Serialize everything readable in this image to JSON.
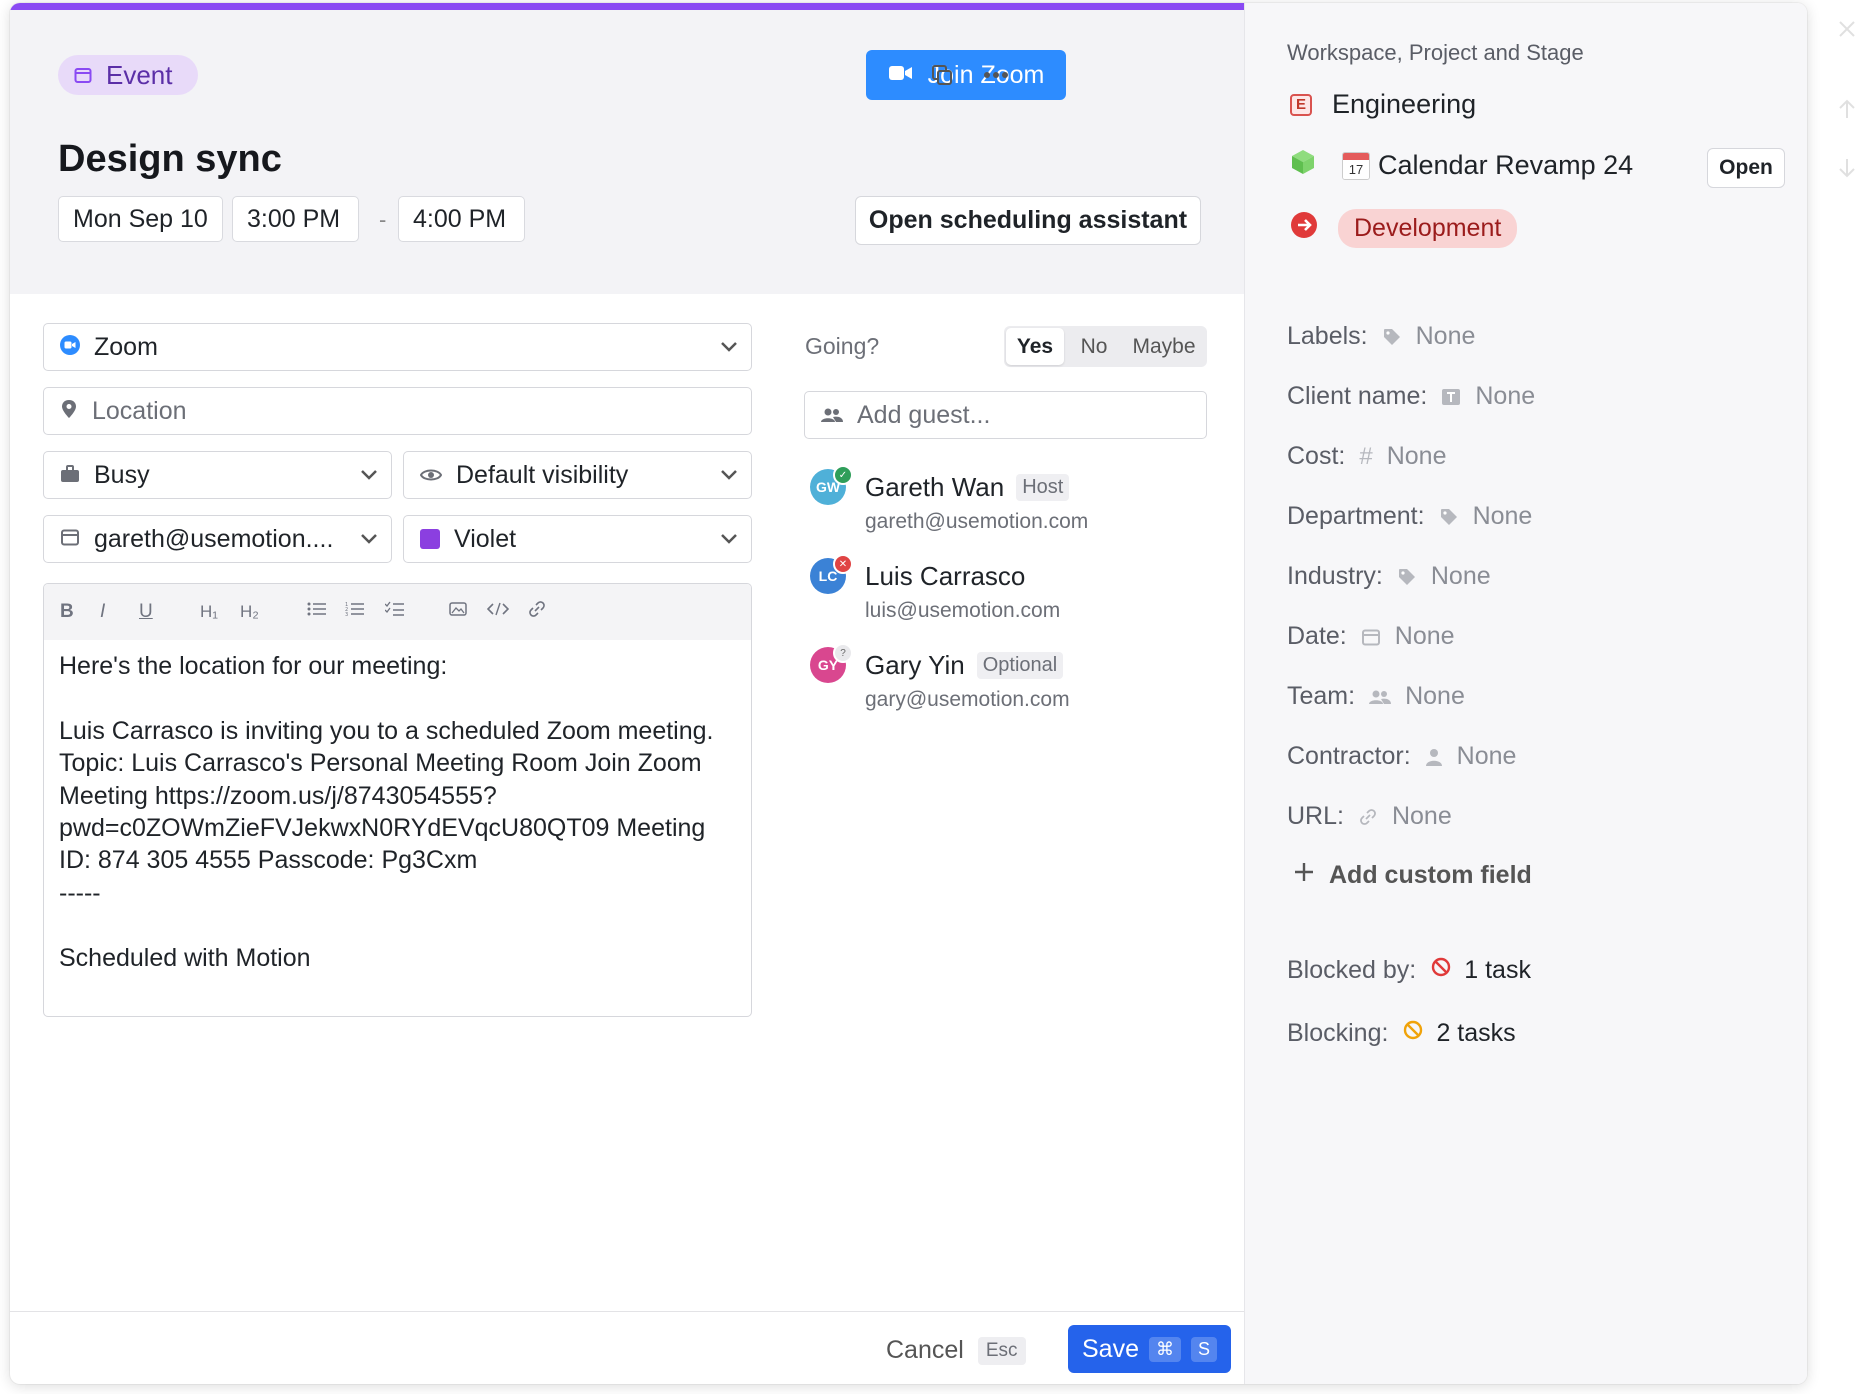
{
  "header": {
    "badge_label": "Event",
    "join_button": "Join Zoom",
    "title": "Design sync",
    "date": "Mon Sep 10",
    "start_time": "3:00 PM",
    "separator": "-",
    "end_time": "4:00 PM",
    "scheduling_button": "Open scheduling assistant"
  },
  "form": {
    "conferencing": "Zoom",
    "location_placeholder": "Location",
    "busy": "Busy",
    "visibility": "Default visibility",
    "calendar": "gareth@usemotion....",
    "color_label": "Violet",
    "color_hex": "#8b3fe0"
  },
  "description": "Here's the location for our meeting:\n\nLuis Carrasco is inviting you to a scheduled Zoom meeting. Topic: Luis Carrasco's Personal Meeting Room Join Zoom Meeting https://zoom.us/j/8743054555?pwd=c0ZOWmZieFVJekwxN0RYdEVqcU80QT09 Meeting ID: 874 305 4555 Passcode: Pg3Cxm\n-----\n\nScheduled with Motion",
  "editor_toolbar": [
    "bold",
    "italic",
    "underline",
    "heading-1",
    "heading-2",
    "bullet-list",
    "numbered-list",
    "checklist",
    "image",
    "code",
    "link"
  ],
  "going": {
    "label": "Going?",
    "options": [
      "Yes",
      "No",
      "Maybe"
    ],
    "selected": "Yes"
  },
  "guests": {
    "add_placeholder": "Add guest...",
    "list": [
      {
        "initials": "GW",
        "name": "Gareth Wan",
        "tag": "Host",
        "email": "gareth@usemotion.com",
        "color": "#4fb0d8",
        "status": "accepted"
      },
      {
        "initials": "LC",
        "name": "Luis Carrasco",
        "tag": "",
        "email": "luis@usemotion.com",
        "color": "#3b82d6",
        "status": "declined"
      },
      {
        "initials": "GY",
        "name": "Gary Yin",
        "tag": "Optional",
        "email": "gary@usemotion.com",
        "color": "#d9478f",
        "status": "pending"
      }
    ]
  },
  "footer": {
    "cancel": "Cancel",
    "cancel_key": "Esc",
    "save": "Save",
    "save_key_1": "⌘",
    "save_key_2": "S"
  },
  "sidebar": {
    "heading": "Workspace, Project and Stage",
    "workspace": "Engineering",
    "workspace_letter": "E",
    "project": "Calendar Revamp 24",
    "project_emoji_day": "17",
    "open_button": "Open",
    "stage": "Development",
    "properties": [
      {
        "label": "Labels:",
        "icon": "tag-icon",
        "value": "None"
      },
      {
        "label": "Client name:",
        "icon": "text-field-icon",
        "value": "None"
      },
      {
        "label": "Cost:",
        "icon": "hash-icon",
        "value": "None"
      },
      {
        "label": "Department:",
        "icon": "tag-icon",
        "value": "None"
      },
      {
        "label": "Industry:",
        "icon": "tag-icon",
        "value": "None"
      },
      {
        "label": "Date:",
        "icon": "calendar-icon",
        "value": "None"
      },
      {
        "label": "Team:",
        "icon": "team-icon",
        "value": "None"
      },
      {
        "label": "Contractor:",
        "icon": "person-icon",
        "value": "None"
      },
      {
        "label": "URL:",
        "icon": "link-icon",
        "value": "None"
      }
    ],
    "add_custom_field": "Add custom field",
    "blocked_by_label": "Blocked by:",
    "blocked_by_value": "1 task",
    "blocking_label": "Blocking:",
    "blocking_value": "2 tasks"
  }
}
